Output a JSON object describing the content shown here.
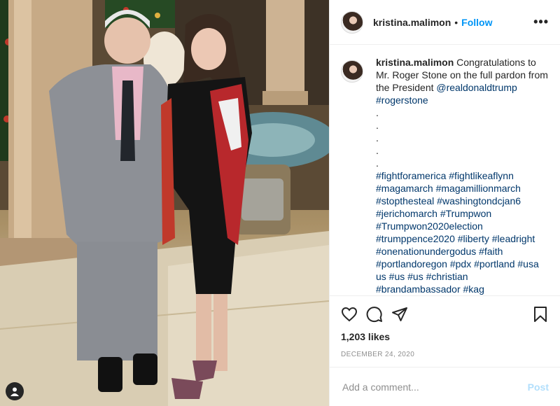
{
  "header": {
    "username": "kristina.malimon",
    "separator": "•",
    "follow_label": "Follow",
    "more_icon": "more-options-icon"
  },
  "caption": {
    "username": "kristina.malimon",
    "text_1": "Congratulations to Mr. Roger Stone on the full pardon from the President",
    "mention": "@realdonaldtrump",
    "hashtag_1": "#rogerstone",
    "dots": [
      ".",
      ".",
      ".",
      ".",
      "."
    ],
    "hashtags": "#fightforamerica #fightlikeaflynn #magamarch #magamillionmarch #stopthesteal #washingtondcjan6 #jerichomarch #Trumpwon #Trumpwon2020election #trumppence2020 #liberty #leadright #onenationundergodus #faith #portlandoregon #pdx #portland #usa us #us #us #christian #brandambassador #kag #kristinamalimon #kristinaportland"
  },
  "actions": {
    "like_icon": "heart-icon",
    "comment_icon": "comment-icon",
    "share_icon": "share-icon",
    "save_icon": "bookmark-icon"
  },
  "likes": "1,203 likes",
  "date": "DECEMBER 24, 2020",
  "comment": {
    "placeholder": "Add a comment...",
    "post_label": "Post"
  },
  "colors": {
    "link": "#00376b",
    "follow": "#0095f6",
    "post_disabled": "#b2dffc",
    "meta": "#8e8e8e"
  }
}
